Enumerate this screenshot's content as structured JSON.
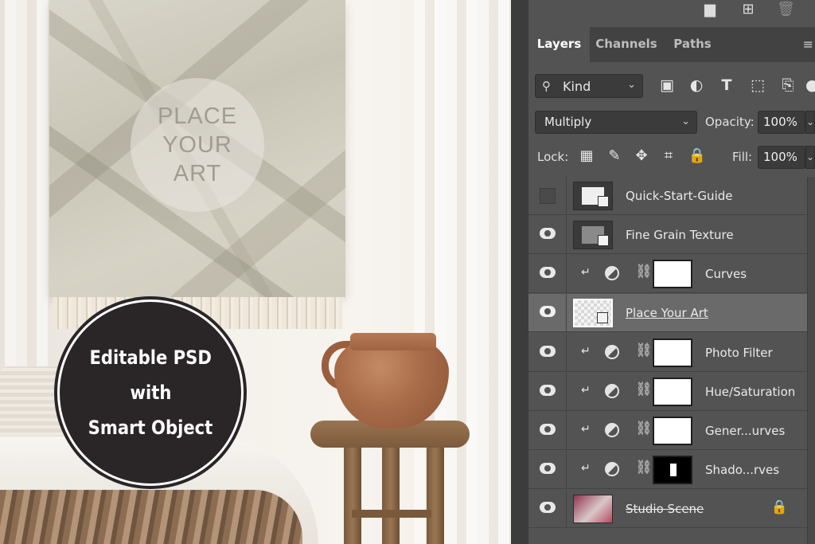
{
  "badge": {
    "line1": "Editable PSD",
    "line2": "with",
    "line3": "Smart Object"
  },
  "artwork": {
    "line1": "PLACE",
    "line2": "YOUR",
    "line3": "ART"
  },
  "panel": {
    "tabs": [
      {
        "label": "Layers",
        "active": true
      },
      {
        "label": "Channels",
        "active": false
      },
      {
        "label": "Paths",
        "active": false
      }
    ],
    "filter": {
      "label": "Kind",
      "icons": [
        "image-filter-icon",
        "adjustment-filter-icon",
        "type-filter-icon",
        "shape-filter-icon",
        "smart-object-filter-icon"
      ]
    },
    "blend_mode": "Multiply",
    "opacity_label": "Opacity:",
    "opacity_value": "100%",
    "lock_label": "Lock:",
    "fill_label": "Fill:",
    "fill_value": "100%",
    "top_icons": [
      "folder-icon",
      "new-layer-icon",
      "trash-icon"
    ]
  },
  "layers": [
    {
      "name": "Quick-Start-Guide",
      "visible": false,
      "type": "smart-object",
      "selected": false
    },
    {
      "name": "Fine Grain Texture",
      "visible": true,
      "type": "smart-object",
      "selected": false
    },
    {
      "name": "Curves",
      "visible": true,
      "type": "adjustment",
      "selected": false
    },
    {
      "name": "Place Your Art",
      "visible": true,
      "type": "smart-object",
      "selected": true
    },
    {
      "name": "Photo Filter",
      "visible": true,
      "type": "adjustment",
      "selected": false
    },
    {
      "name": "Hue/Saturation",
      "visible": true,
      "type": "adjustment",
      "selected": false
    },
    {
      "name": "Gener...urves",
      "visible": true,
      "type": "adjustment",
      "selected": false
    },
    {
      "name": "Shado...rves",
      "visible": true,
      "type": "adjustment",
      "selected": false
    },
    {
      "name": "Studio Scene",
      "visible": true,
      "type": "background",
      "selected": false,
      "locked": true
    }
  ]
}
